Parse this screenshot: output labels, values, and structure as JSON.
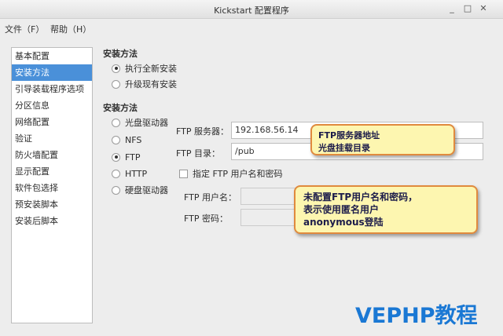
{
  "window": {
    "title": "Kickstart 配置程序",
    "minimize_glyph": "_",
    "maximize_glyph": "□",
    "close_glyph": "✕"
  },
  "menubar": {
    "items": [
      {
        "label": "文件（F）"
      },
      {
        "label": "帮助（H）"
      }
    ]
  },
  "sidebar": {
    "selected_index": 1,
    "items": [
      {
        "label": "基本配置"
      },
      {
        "label": "安装方法"
      },
      {
        "label": "引导装载程序选项"
      },
      {
        "label": "分区信息"
      },
      {
        "label": "网络配置"
      },
      {
        "label": "验证"
      },
      {
        "label": "防火墙配置"
      },
      {
        "label": "显示配置"
      },
      {
        "label": "软件包选择"
      },
      {
        "label": "预安装脚本"
      },
      {
        "label": "安装后脚本"
      }
    ]
  },
  "install_method": {
    "title": "安装方法",
    "options": [
      {
        "label": "执行全新安装",
        "checked": true
      },
      {
        "label": "升级现有安装",
        "checked": false
      }
    ]
  },
  "install_source": {
    "title": "安装方法",
    "options": [
      {
        "label": "光盘驱动器",
        "checked": false
      },
      {
        "label": "NFS",
        "checked": false
      },
      {
        "label": "FTP",
        "checked": true
      },
      {
        "label": "HTTP",
        "checked": false
      },
      {
        "label": "硬盘驱动器",
        "checked": false
      }
    ]
  },
  "ftp": {
    "server_label": "FTP 服务器：",
    "server_value": "192.168.56.14",
    "dir_label": "FTP 目录：",
    "dir_value": "/pub",
    "specify_label": "指定 FTP 用户名和密码",
    "specify_checked": false,
    "user_label": "FTP 用户名：",
    "user_value": "",
    "pass_label": "FTP 密码：",
    "pass_value": ""
  },
  "callouts": {
    "one": [
      "FTP服务器地址",
      "光盘挂载目录"
    ],
    "two": [
      "未配置FTP用户名和密码，",
      "表示使用匿名用户",
      "anonymous登陆"
    ]
  },
  "watermark": "VEPHP教程"
}
